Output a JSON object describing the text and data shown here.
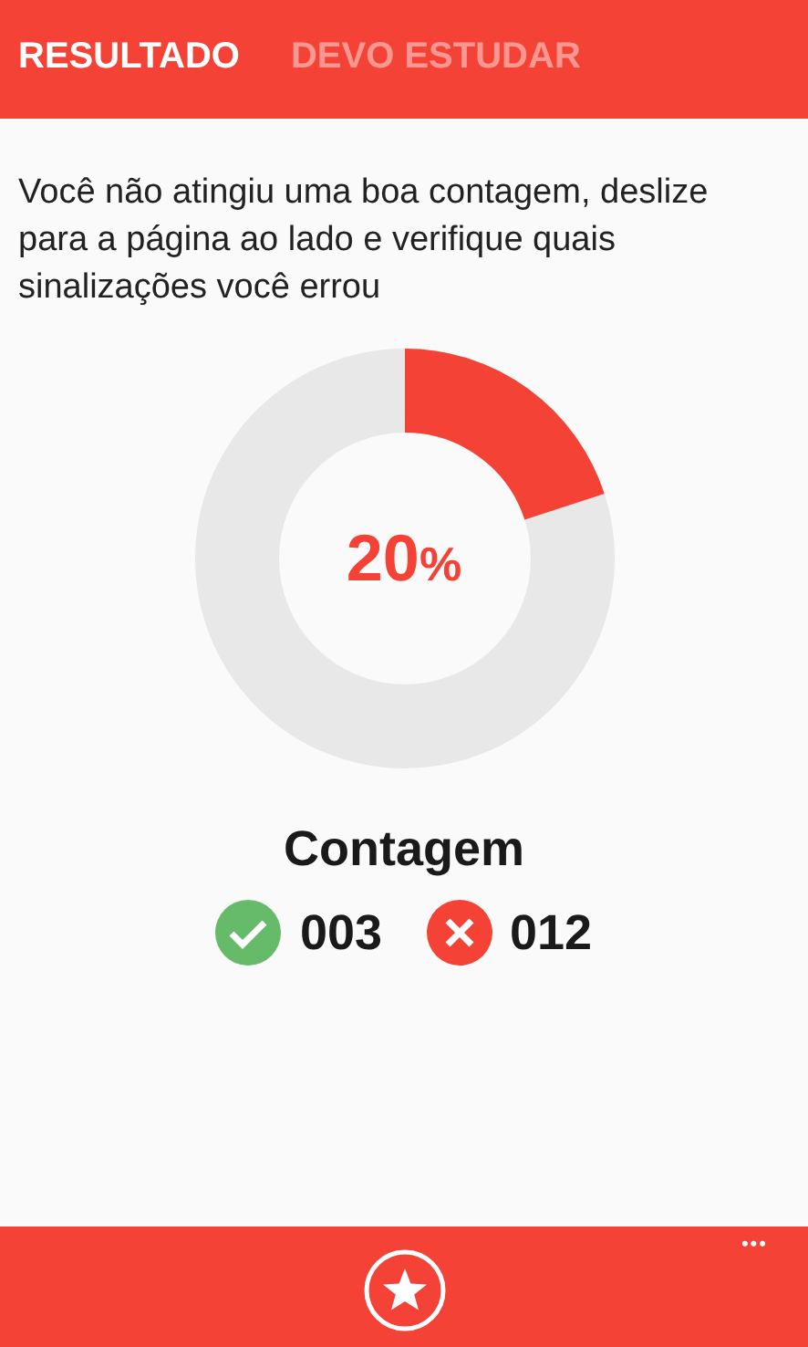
{
  "tabs": [
    {
      "label": "RESULTADO",
      "selected": true
    },
    {
      "label": "DEVO ESTUDAR",
      "selected": false
    }
  ],
  "message": "Você não atingiu uma boa contagem, deslize para a página ao lado e verifique quais sinalizações você errou",
  "score": {
    "level": 0.2,
    "value": "20",
    "unit": "%"
  },
  "count": {
    "title": "Contagem",
    "items": [
      {
        "kind": "correct",
        "value": "003"
      },
      {
        "kind": "wrong",
        "value": "012"
      }
    ]
  },
  "app_bar": {
    "more": "•••"
  }
}
